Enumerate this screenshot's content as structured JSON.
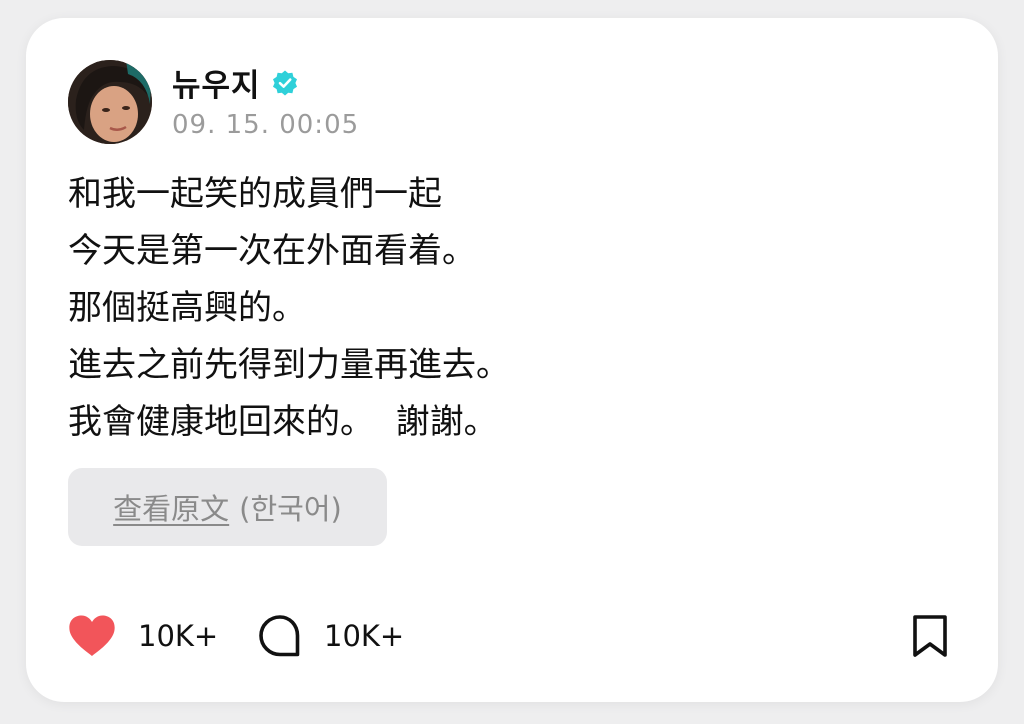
{
  "post": {
    "author": "뉴우지",
    "verified": true,
    "verified_icon": "verified-badge-icon",
    "timestamp": "09. 15. 00:05",
    "body_lines": [
      "和我一起笑的成員們一起",
      "今天是第一次在外面看着。",
      "那個挺高興的。",
      "進去之前先得到力量再進去。",
      "我會健康地回來的。  謝謝。"
    ],
    "translate": {
      "link_label": "查看原文",
      "language_label": "(한국어)"
    },
    "actions": {
      "likes_count": "10K+",
      "comments_count": "10K+"
    }
  },
  "colors": {
    "background": "#eeeeef",
    "card": "#ffffff",
    "verified": "#2fd0d9",
    "like": "#f2555a",
    "text": "#111111",
    "muted": "#9b9b9b"
  }
}
